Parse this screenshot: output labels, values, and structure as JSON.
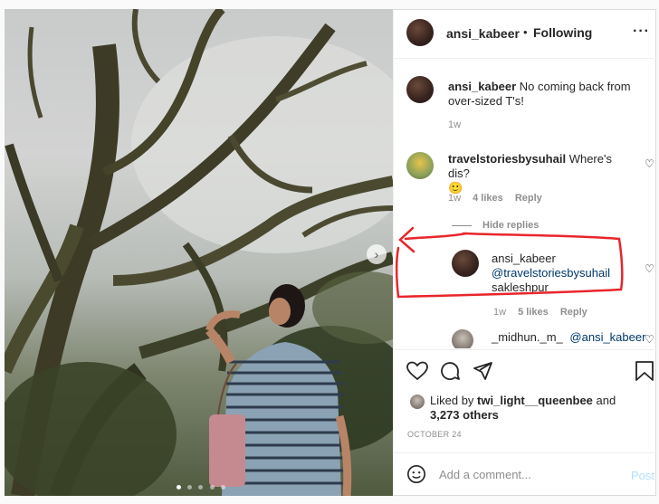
{
  "header": {
    "username": "ansi_kabeer",
    "separator": "•",
    "follow_status": "Following",
    "more_icon": "ellipsis-icon"
  },
  "caption": {
    "username": "ansi_kabeer",
    "text": "No coming back from over-sized T's!",
    "time": "1w"
  },
  "comments": [
    {
      "username": "travelstoriesbysuhail",
      "text": "Where's dis?",
      "emoji": "🙂",
      "time": "1w",
      "likes": "4 likes",
      "reply": "Reply"
    }
  ],
  "hide_replies": "Hide replies",
  "reply": {
    "username": "ansi_kabeer",
    "mention": "@travelstoriesbysuhail",
    "text": "sakleshpur",
    "time": "1w",
    "likes": "5 likes",
    "reply": "Reply"
  },
  "partial_comment": {
    "username": "_midhun._m_",
    "mention": "@ansi_kabeer"
  },
  "liked_by": {
    "prefix": "Liked by",
    "user": "twi_light__queenbee",
    "and": "and",
    "others": "3,273 others"
  },
  "date": "OCTOBER 24",
  "add_comment": {
    "placeholder": "Add a comment...",
    "post_label": "Post"
  },
  "carousel": {
    "dots": 5,
    "active": 0
  },
  "colors": {
    "annotation_red": "#e8262b",
    "link": "#00376b",
    "post_disabled": "#b2dffc"
  }
}
